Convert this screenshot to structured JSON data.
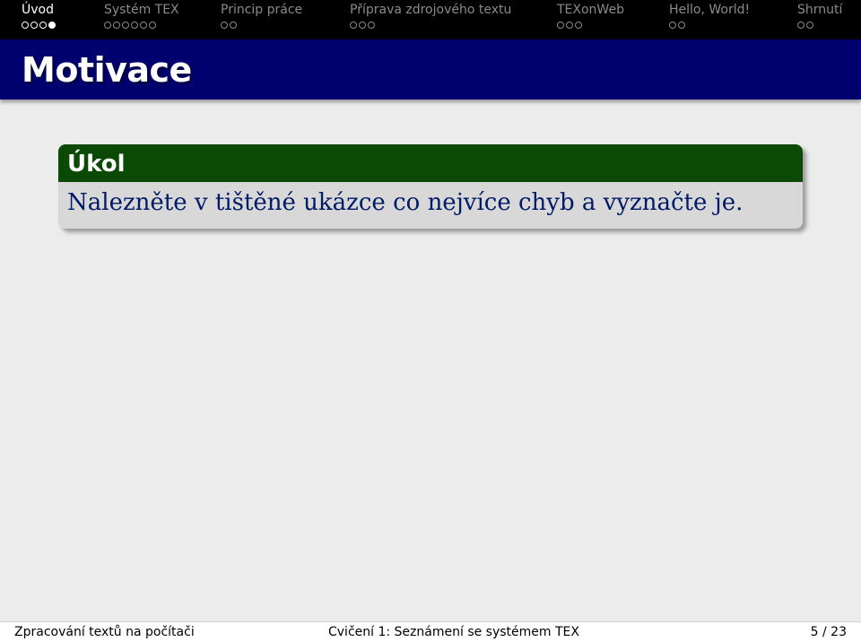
{
  "nav": {
    "items": [
      {
        "label": "Úvod",
        "dots": 4,
        "filled_index": 3,
        "active": true
      },
      {
        "label": "Systém TEX",
        "dots": 6,
        "filled_index": -1,
        "active": false
      },
      {
        "label": "Princip práce",
        "dots": 2,
        "filled_index": -1,
        "active": false
      },
      {
        "label": "Příprava zdrojového textu",
        "dots": 3,
        "filled_index": -1,
        "active": false
      },
      {
        "label": "TEXonWeb",
        "dots": 3,
        "filled_index": -1,
        "active": false
      },
      {
        "label": "Hello, World!",
        "dots": 2,
        "filled_index": -1,
        "active": false
      },
      {
        "label": "Shrnutí",
        "dots": 2,
        "filled_index": -1,
        "active": false
      }
    ]
  },
  "frame": {
    "title": "Motivace"
  },
  "block": {
    "title": "Úkol",
    "body": "Nalezněte v tištěné ukázce co nejvíce chyb a vyznačte je."
  },
  "footer": {
    "left": "Zpracování textů na počítači",
    "center": "Cvičení 1: Seznámení se systémem TEX",
    "page": "5 / 23"
  },
  "colors": {
    "nav_bg": "#000000",
    "title_bg": "#00006e",
    "block_title_bg": "#0a4a04",
    "block_body_bg": "#d8d8d8",
    "block_text": "#001a66"
  }
}
